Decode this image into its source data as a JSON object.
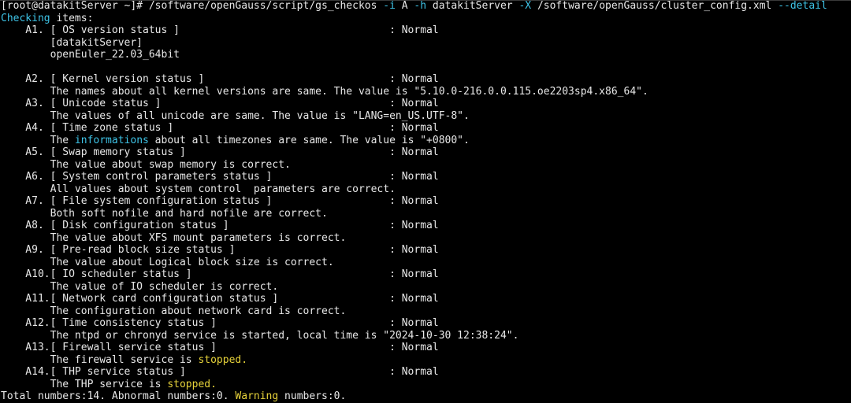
{
  "terminal": {
    "colors": {
      "background": "#000000",
      "default": "#e8e8e8",
      "cyan": "#3ec3e6",
      "yellow": "#e6d23a"
    },
    "lines": [
      [
        {
          "t": "[root@datakitServer ~]# /software/openGauss/script/gs_checkos "
        },
        {
          "t": "-i",
          "c": "cyan"
        },
        {
          "t": " A "
        },
        {
          "t": "-h",
          "c": "cyan"
        },
        {
          "t": " datakitServer "
        },
        {
          "t": "-X",
          "c": "cyan"
        },
        {
          "t": " /software/openGauss/cluster_config.xml "
        },
        {
          "t": "--detail",
          "c": "cyan"
        }
      ],
      [
        {
          "t": "Checking",
          "c": "cyan"
        },
        {
          "t": " items:"
        }
      ],
      [
        {
          "t": "    A1. [ OS version status ]                                  : Normal"
        }
      ],
      [
        {
          "t": "        [datakitServer]"
        }
      ],
      [
        {
          "t": "        openEuler_22.03_64bit"
        }
      ],
      [
        {
          "t": ""
        }
      ],
      [
        {
          "t": "    A2. [ Kernel version status ]                              : Normal"
        }
      ],
      [
        {
          "t": "        The names about all kernel versions are same. The value is \"5.10.0-216.0.0.115.oe2203sp4.x86_64\"."
        }
      ],
      [
        {
          "t": "    A3. [ Unicode status ]                                     : Normal"
        }
      ],
      [
        {
          "t": "        The values of all unicode are same. The value is \"LANG=en_US.UTF-8\"."
        }
      ],
      [
        {
          "t": "    A4. [ Time zone status ]                                   : Normal"
        }
      ],
      [
        {
          "t": "        The "
        },
        {
          "t": "informations",
          "c": "cyan"
        },
        {
          "t": " about all timezones are same. The value is \"+0800\"."
        }
      ],
      [
        {
          "t": "    A5. [ Swap memory status ]                                 : Normal"
        }
      ],
      [
        {
          "t": "        The value about swap memory is correct."
        }
      ],
      [
        {
          "t": "    A6. [ System control parameters status ]                   : Normal"
        }
      ],
      [
        {
          "t": "        All values about system control  parameters are correct."
        }
      ],
      [
        {
          "t": "    A7. [ File system configuration status ]                   : Normal"
        }
      ],
      [
        {
          "t": "        Both soft nofile and hard nofile are correct."
        }
      ],
      [
        {
          "t": "    A8. [ Disk configuration status ]                          : Normal"
        }
      ],
      [
        {
          "t": "        The value about XFS mount parameters is correct."
        }
      ],
      [
        {
          "t": "    A9. [ Pre-read block size status ]                         : Normal"
        }
      ],
      [
        {
          "t": "        The value about Logical block size is correct."
        }
      ],
      [
        {
          "t": "    A10.[ IO scheduler status ]                                : Normal"
        }
      ],
      [
        {
          "t": "        The value of IO scheduler is correct."
        }
      ],
      [
        {
          "t": "    A11.[ Network card configuration status ]                  : Normal"
        }
      ],
      [
        {
          "t": "        The configuration about network card is correct."
        }
      ],
      [
        {
          "t": "    A12.[ Time consistency status ]                            : Normal"
        }
      ],
      [
        {
          "t": "        The ntpd or chronyd service is started, local time is \"2024-10-30 12:38:24\"."
        }
      ],
      [
        {
          "t": "    A13.[ Firewall service status ]                            : Normal"
        }
      ],
      [
        {
          "t": "        The firewall service is "
        },
        {
          "t": "stopped.",
          "c": "yellow"
        }
      ],
      [
        {
          "t": "    A14.[ THP service status ]                                 : Normal"
        }
      ],
      [
        {
          "t": "        The THP service is "
        },
        {
          "t": "stopped.",
          "c": "yellow"
        }
      ],
      [
        {
          "t": "Total numbers:14. Abnormal numbers:0. "
        },
        {
          "t": "Warning",
          "c": "yellow"
        },
        {
          "t": " numbers:0."
        }
      ]
    ]
  }
}
